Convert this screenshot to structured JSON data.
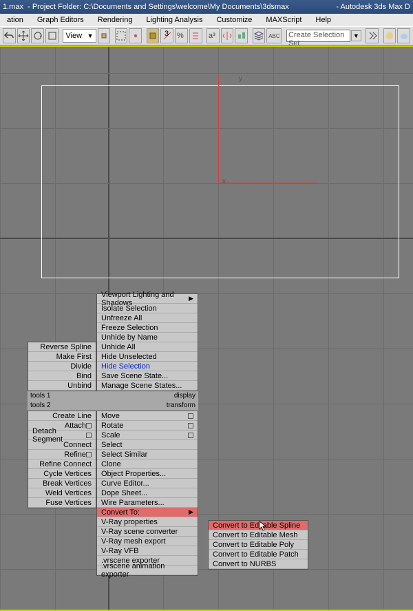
{
  "title_file": "1.max",
  "title_project": "- Project Folder: C:\\Documents and Settings\\welcome\\My Documents\\3dsmax",
  "title_app": "- Autodesk 3ds Max D",
  "menubar": {
    "ation": "ation",
    "graph": "Graph Editors",
    "rendering": "Rendering",
    "lighting": "Lighting Analysis",
    "customize": "Customize",
    "maxscript": "MAXScript",
    "help": "Help"
  },
  "view_label": "View",
  "selset_placeholder": "Create Selection Set",
  "axis": {
    "y": "y",
    "x": "x"
  },
  "left_panel": {
    "items": [
      "Reverse Spline",
      "Make First",
      "Divide",
      "Bind",
      "Unbind"
    ],
    "head1": "tools 1",
    "head2": "tools 2",
    "items2": [
      "Create Line",
      "Attach",
      "Detach Segment",
      "Connect",
      "Refine",
      "Refine Connect",
      "Cycle Vertices",
      "Break Vertices",
      "Weld Vertices",
      "Fuse Vertices"
    ]
  },
  "main_panel": {
    "items1": [
      "Viewport Lighting and Shadows",
      "Isolate Selection",
      "Unfreeze All",
      "Freeze Selection",
      "Unhide by Name",
      "Unhide All",
      "Hide Unselected",
      "Hide Selection",
      "Save Scene State...",
      "Manage Scene States..."
    ],
    "head_display": "display",
    "head_transform": "transform",
    "items2": [
      "Move",
      "Rotate",
      "Scale",
      "Select",
      "Select Similar",
      "Clone",
      "Object Properties...",
      "Curve Editor...",
      "Dope Sheet...",
      "Wire Parameters...",
      "Convert To:",
      "V-Ray properties",
      "V-Ray scene converter",
      "V-Ray mesh export",
      "V-Ray VFB",
      ".vrscene exporter",
      ".vrscene animation exporter"
    ]
  },
  "convert_panel": {
    "items": [
      "Convert to Editable Spline",
      "Convert to Editable Mesh",
      "Convert to Editable Poly",
      "Convert to Editable Patch",
      "Convert to NURBS"
    ]
  }
}
